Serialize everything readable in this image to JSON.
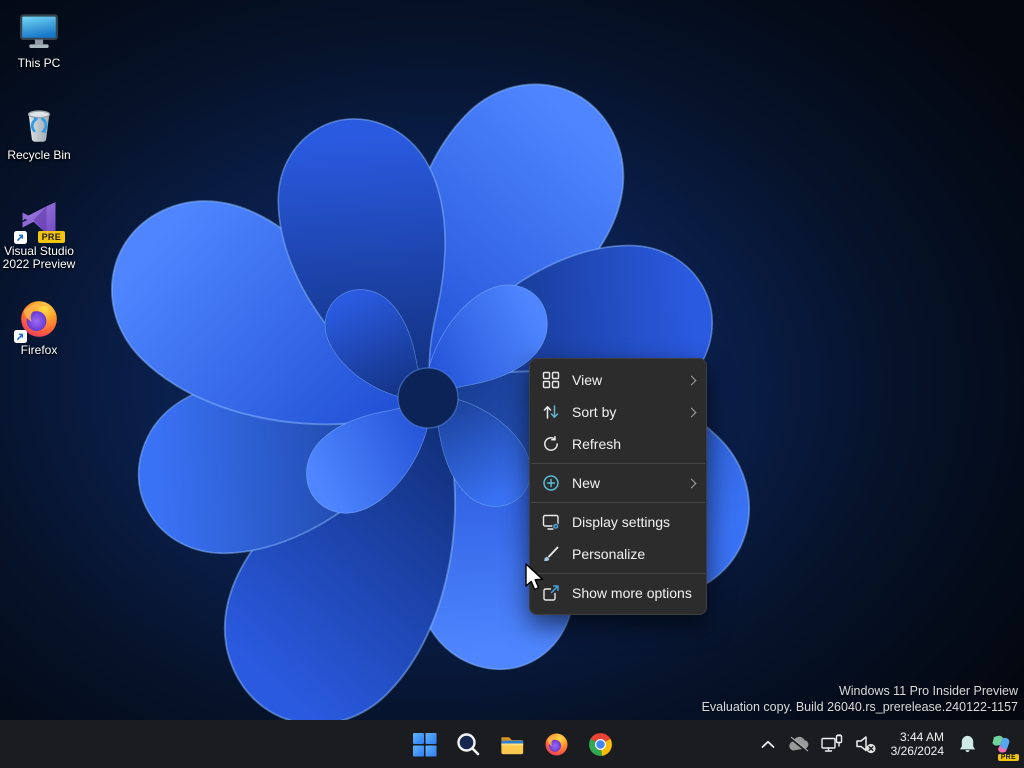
{
  "desktop": {
    "icons": [
      {
        "label": "This PC",
        "icon": "this-pc-icon"
      },
      {
        "label": "Recycle Bin",
        "icon": "recycle-bin-icon"
      },
      {
        "label": "Visual Studio 2022 Preview",
        "icon": "visual-studio-icon",
        "badge": "PRE"
      },
      {
        "label": "Firefox",
        "icon": "firefox-icon"
      }
    ],
    "watermark": {
      "line1": "Windows 11 Pro Insider Preview",
      "line2": "Evaluation copy. Build 26040.rs_prerelease.240122-1157"
    }
  },
  "context_menu": {
    "items": [
      {
        "label": "View",
        "icon": "view-grid-icon",
        "has_submenu": true
      },
      {
        "label": "Sort by",
        "icon": "sort-by-icon",
        "has_submenu": true
      },
      {
        "label": "Refresh",
        "icon": "refresh-icon",
        "has_submenu": false
      },
      {
        "label": "New",
        "icon": "new-item-icon",
        "has_submenu": true
      },
      {
        "label": "Display settings",
        "icon": "display-settings-icon",
        "has_submenu": false
      },
      {
        "label": "Personalize",
        "icon": "personalize-icon",
        "has_submenu": false
      },
      {
        "label": "Show more options",
        "icon": "show-more-options-icon",
        "has_submenu": false
      }
    ]
  },
  "taskbar": {
    "app_buttons": [
      {
        "name": "start",
        "icon": "windows-start-icon"
      },
      {
        "name": "search",
        "icon": "search-icon"
      },
      {
        "name": "file-explorer",
        "icon": "file-explorer-icon"
      },
      {
        "name": "firefox",
        "icon": "firefox-icon"
      },
      {
        "name": "chrome",
        "icon": "chrome-icon"
      }
    ],
    "tray": {
      "icons": [
        {
          "name": "hidden-icons",
          "icon": "chevron-up-icon"
        },
        {
          "name": "onedrive-offline",
          "icon": "onedrive-offline-icon"
        },
        {
          "name": "network-ethernet",
          "icon": "ethernet-icon"
        },
        {
          "name": "volume-muted",
          "icon": "volume-muted-icon"
        }
      ],
      "clock": {
        "time": "3:44 AM",
        "date": "3/26/2024"
      },
      "copilot": {
        "icon": "copilot-preview-icon",
        "badge": "PRE"
      }
    }
  },
  "colors": {
    "accent": "#4cc2ff",
    "menu_background": "#2c2c2c",
    "taskbar_background": "#1b1c20",
    "wallpaper_blue": "#2e63f0"
  }
}
